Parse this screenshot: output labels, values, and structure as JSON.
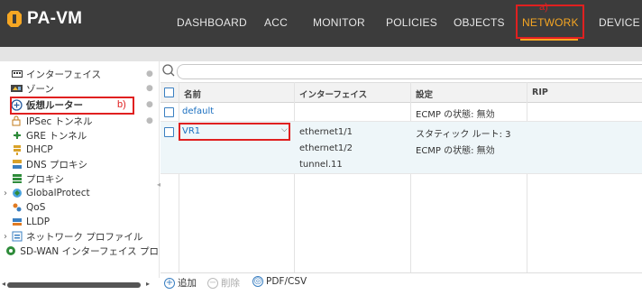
{
  "app": {
    "title": "PA-VM"
  },
  "nav": {
    "items": [
      "DASHBOARD",
      "ACC",
      "MONITOR",
      "POLICIES",
      "OBJECTS",
      "NETWORK",
      "DEVICE"
    ],
    "active": "NETWORK",
    "accent": "#f5a623"
  },
  "callouts": {
    "a": "a)",
    "b": "b)"
  },
  "sidebar": {
    "items": [
      {
        "label": "インターフェイス",
        "icon": "interface-icon"
      },
      {
        "label": "ゾーン",
        "icon": "zone-icon"
      },
      {
        "label": "仮想ルーター",
        "icon": "virtual-router-icon",
        "selected": true
      },
      {
        "label": "IPSec トンネル",
        "icon": "ipsec-tunnel-icon"
      },
      {
        "label": "GRE トンネル",
        "icon": "gre-tunnel-icon"
      },
      {
        "label": "DHCP",
        "icon": "dhcp-icon"
      },
      {
        "label": "DNS プロキシ",
        "icon": "dns-proxy-icon"
      },
      {
        "label": "プロキシ",
        "icon": "proxy-icon"
      },
      {
        "label": "GlobalProtect",
        "icon": "globalprotect-icon"
      },
      {
        "label": "QoS",
        "icon": "qos-icon"
      },
      {
        "label": "LLDP",
        "icon": "lldp-icon"
      },
      {
        "label": "ネットワーク プロファイル",
        "icon": "network-profiles-icon"
      },
      {
        "label": "SD-WAN インターフェイス プロ",
        "icon": "sdwan-icon"
      }
    ]
  },
  "table": {
    "headers": {
      "name": "名前",
      "interface": "インターフェイス",
      "config": "設定",
      "rip": "RIP"
    },
    "rows": [
      {
        "name": "default",
        "interfaces": [],
        "config": [
          "ECMP の状態: 無効"
        ]
      },
      {
        "name": "VR1",
        "interfaces": [
          "ethernet1/1",
          "ethernet1/2",
          "tunnel.11"
        ],
        "config": [
          "スタティック ルート: 3",
          "ECMP の状態: 無効"
        ]
      }
    ]
  },
  "footer": {
    "add": "追加",
    "delete": "削除",
    "pdf": "PDF/CSV"
  }
}
